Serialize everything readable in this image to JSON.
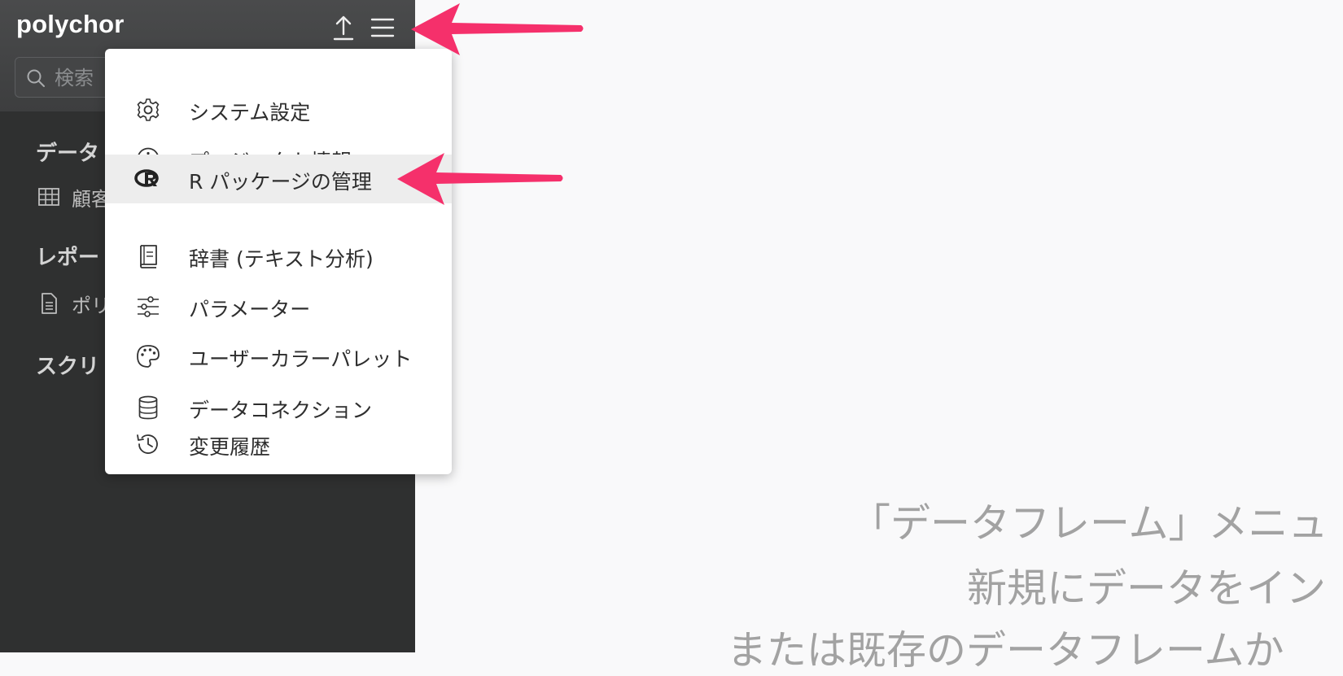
{
  "app": {
    "title": "polychor"
  },
  "search": {
    "placeholder": "検索"
  },
  "sidebar": {
    "sections": [
      {
        "title": "データ",
        "items": [
          {
            "label": "顧客",
            "icon": "table-icon"
          }
        ]
      },
      {
        "title": "レポート",
        "items": [
          {
            "label": "ポリ",
            "icon": "document-icon"
          }
        ]
      },
      {
        "title": "スクリ",
        "items": []
      }
    ]
  },
  "menu": {
    "items": [
      {
        "label": "システム設定",
        "icon": "gear-icon"
      },
      {
        "label": "プロジェクト情報",
        "icon": "info-icon"
      },
      {
        "label": "R パッケージの管理",
        "icon": "r-logo-icon",
        "highlighted": true
      },
      {
        "label": "辞書 (テキスト分析)",
        "icon": "book-icon"
      },
      {
        "label": "パラメーター",
        "icon": "sliders-icon"
      },
      {
        "label": "ユーザーカラーパレット",
        "icon": "palette-icon"
      },
      {
        "label": "データコネクション",
        "icon": "database-icon"
      },
      {
        "label": "変更履歴",
        "icon": "history-icon"
      }
    ]
  },
  "main": {
    "lines": [
      "「データフレーム」メニュ",
      "新規にデータをイン",
      "または既存のデータフレームか"
    ]
  },
  "annotation": {
    "arrow_color": "#f5306b"
  }
}
